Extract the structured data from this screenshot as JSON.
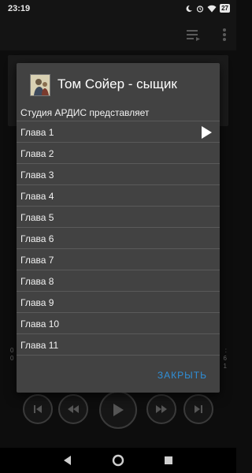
{
  "status_bar": {
    "time": "23:19",
    "battery": "27"
  },
  "background": {
    "side_left": [
      "0",
      "0"
    ],
    "side_right": [
      ":",
      "6",
      "1"
    ]
  },
  "dialog": {
    "title": "Том Сойер - сыщик",
    "subtitle": "Студия АРДИС представляет",
    "chapters": [
      "Глава 1",
      "Глава 2",
      "Глава 3",
      "Глава 4",
      "Глава 5",
      "Глава 6",
      "Глава 7",
      "Глава 8",
      "Глава 9",
      "Глава 10",
      "Глава 11"
    ],
    "now_playing_index": 0,
    "close_label": "ЗАКРЫТЬ",
    "accent_color": "#2f8fd8"
  },
  "icons": [
    "moon-icon",
    "alarm-icon",
    "wifi-icon",
    "battery-icon",
    "queue-icon",
    "more-icon",
    "play-icon",
    "skip-previous-icon",
    "rewind-icon",
    "fast-forward-icon",
    "skip-next-icon",
    "nav-back-icon",
    "nav-home-icon",
    "nav-recents-icon"
  ]
}
